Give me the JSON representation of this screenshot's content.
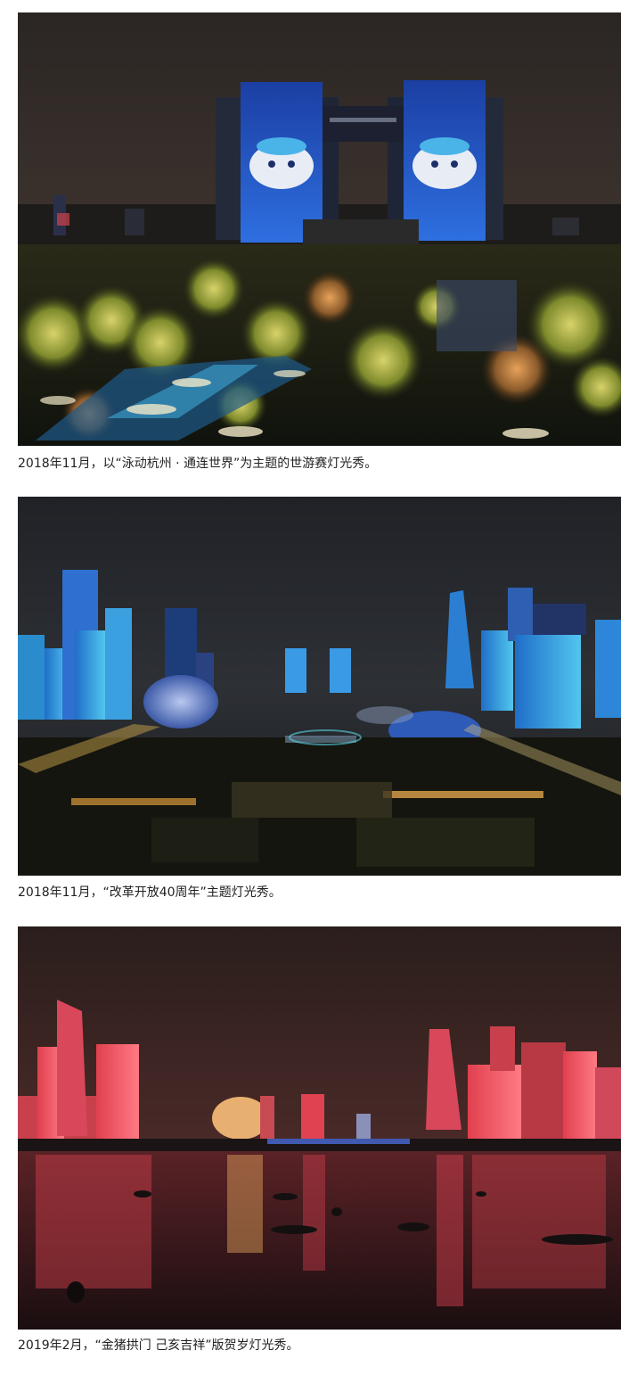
{
  "photos": [
    {
      "subject": "Twin towers lit with mascot figures above an illuminated park at night",
      "caption": "2018年11月，以“泳动杭州 · 通连世界”为主题的世游赛灯光秀。"
    },
    {
      "subject": "Aerial night skyline with blue-lit towers, a spherical hall and a city square",
      "caption": "2018年11月，“改革开放40周年”主题灯光秀。"
    },
    {
      "subject": "Riverside skyline glowing red with reflections on the water and small boats",
      "caption": "2019年2月，“金猪拱门 己亥吉祥”版贺岁灯光秀。"
    }
  ]
}
